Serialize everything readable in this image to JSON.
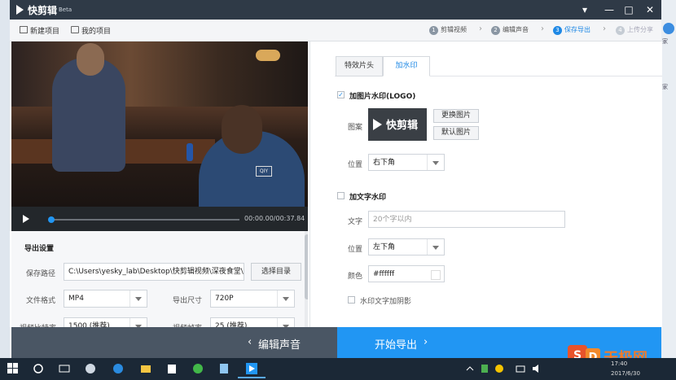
{
  "app": {
    "title": "快剪辑",
    "badge": "Beta"
  },
  "window_controls": {
    "menu": "▾",
    "minimize": "—",
    "maximize": "□",
    "close": "✕"
  },
  "toolbar": {
    "new_project": "新建项目",
    "my_projects": "我的项目"
  },
  "steps": [
    {
      "num": "1",
      "label": "剪辑视频"
    },
    {
      "num": "2",
      "label": "编辑声音"
    },
    {
      "num": "3",
      "label": "保存导出"
    },
    {
      "num": "4",
      "label": "上传分享"
    }
  ],
  "player": {
    "time": "00:00.00/00:37.84",
    "progress": 0.0
  },
  "video_watermark": "QIY",
  "export": {
    "title": "导出设置",
    "save_path_label": "保存路径",
    "save_path_value": "C:\\Users\\yesky_lab\\Desktop\\快剪辑视频\\深夜食堂\\",
    "choose_dir": "选择目录",
    "format_label": "文件格式",
    "format_value": "MP4",
    "size_label": "导出尺寸",
    "size_value": "720P",
    "bitrate_label": "视频比特率",
    "bitrate_value": "1500 (推荐)",
    "framerate_label": "视频帧率",
    "framerate_value": "25 (推荐)"
  },
  "tabs": [
    {
      "label": "特效片头"
    },
    {
      "label": "加水印"
    }
  ],
  "image_watermark": {
    "checked": true,
    "title": "加图片水印(LOGO)",
    "pattern_label": "图案",
    "preview_text": "快剪辑",
    "change_image": "更换图片",
    "default_image": "默认图片",
    "position_label": "位置",
    "position_value": "右下角"
  },
  "text_watermark": {
    "checked": false,
    "title": "加文字水印",
    "text_label": "文字",
    "text_placeholder": "20个字以内",
    "position_label": "位置",
    "position_value": "左下角",
    "color_label": "颜色",
    "color_value": "#ffffff",
    "shadow_label": "水印文字加阴影"
  },
  "bottom": {
    "back": "编辑声音",
    "start": "开始导出"
  },
  "taskbar": {
    "time": "17:40",
    "date": "2017/6/30"
  },
  "desktop_right": [
    "家",
    "家"
  ],
  "colors": {
    "accent": "#2196f3",
    "titlebar": "#2f3a47",
    "back_bar": "#4a5664"
  },
  "brand_logo": "天极网"
}
